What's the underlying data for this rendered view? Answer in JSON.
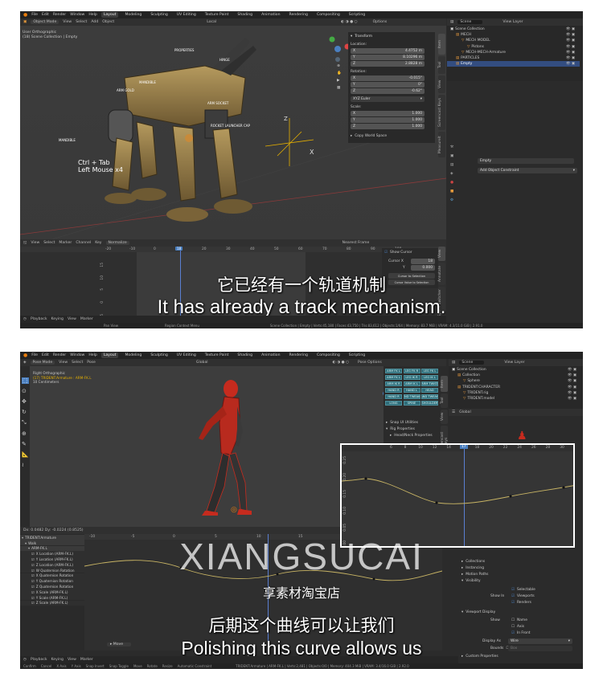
{
  "menu": [
    "File",
    "Edit",
    "Render",
    "Window",
    "Help"
  ],
  "workspaces": [
    "Layout",
    "Modeling",
    "Sculpting",
    "UV Editing",
    "Texture Paint",
    "Shading",
    "Animation",
    "Rendering",
    "Compositing",
    "Scripting"
  ],
  "shot1": {
    "header": {
      "mode": "Object Mode",
      "items": [
        "View",
        "Select",
        "Add",
        "Object"
      ],
      "transform": "Local",
      "options": "Options"
    },
    "viewport_info": [
      "User Orthographic",
      "(18) Scene Collection | Empty"
    ],
    "bone_labels": [
      "PROPERTIES",
      "ARM GOLD",
      "ARM SOCKET",
      "MANDIBLE",
      "ROCKET LAUNCHER CAP",
      "MANDIBLE",
      "HINGE"
    ],
    "shortcut_hint": [
      "Ctrl + Tab",
      "Left Mouse x4"
    ],
    "transform_panel": {
      "title": "Transform",
      "location_label": "Location:",
      "location": [
        {
          "axis": "X",
          "value": "4.4752 m"
        },
        {
          "axis": "Y",
          "value": "8.10296 m"
        },
        {
          "axis": "Z",
          "value": "2.8828 m"
        }
      ],
      "rotation_label": "Rotation:",
      "rotation": [
        {
          "axis": "X",
          "value": "-0.015°"
        },
        {
          "axis": "Y",
          "value": "0°"
        },
        {
          "axis": "Z",
          "value": "-0.62°"
        }
      ],
      "euler": "XYZ Euler",
      "scale_label": "Scale:",
      "scale": [
        {
          "axis": "X",
          "value": "1.000"
        },
        {
          "axis": "Y",
          "value": "1.000"
        },
        {
          "axis": "Z",
          "value": "1.000"
        }
      ],
      "copy_btn": "Copy World Space"
    },
    "side_tabs": [
      "Item",
      "Tool",
      "View",
      "Screencast Keys",
      "MeasureIt"
    ],
    "outliner": {
      "search": "Scene",
      "view_layer": "View Layer",
      "items": [
        {
          "label": "Scene Collection",
          "indent": 0,
          "selected": false
        },
        {
          "label": "MECH",
          "indent": 1,
          "selected": false
        },
        {
          "label": "MECH MODEL",
          "indent": 2,
          "selected": false
        },
        {
          "label": "Pistons",
          "indent": 3,
          "selected": false
        },
        {
          "label": "MECH-MECH-Armature",
          "indent": 2,
          "selected": false
        },
        {
          "label": "PARTICLES",
          "indent": 1,
          "selected": false
        },
        {
          "label": "Empty",
          "indent": 1,
          "selected": true
        }
      ]
    },
    "props": {
      "object": "Empty",
      "constraint": "Add Object Constraint"
    },
    "graph": {
      "header": [
        "View",
        "Select",
        "Marker",
        "Channel",
        "Key"
      ],
      "normalize": "Normalize",
      "pivot": "Nearest Frame",
      "ticks": [
        "-20",
        "-10",
        "0",
        "10",
        "20",
        "30",
        "40",
        "50",
        "60",
        "70",
        "80",
        "90",
        "100"
      ],
      "current_frame": "18",
      "y_ticks": [
        "15",
        "10",
        "5",
        "0",
        "-5"
      ],
      "panel": {
        "show_cursor": "Show Cursor",
        "cursor_x_label": "Cursor X",
        "cursor_x": "18",
        "cursor_y_label": "Y",
        "cursor_y": "0.000",
        "btn1": "Cursor to Selection",
        "btn2": "Cursor Value to Selection"
      },
      "side_tabs": [
        "View",
        "Annotate",
        "Space Switcher"
      ]
    },
    "timeline": [
      "Playback",
      "Keying",
      "View",
      "Marker"
    ],
    "status": {
      "left": "Pan View",
      "mid": "Region Context Menu",
      "right": "Scene Collection | Empty | Verts:45,180 | Faces:43,750 | Tris:83,612 | Objects:1/64 | Memory: 83.7 MiB | VRAM: 4.3/11.0 GiB | 2.91.0"
    },
    "subtitle_zh": "它已经有一个轨道机制",
    "subtitle_en": "It has already a track mechanism."
  },
  "shot2": {
    "header": {
      "mode": "Pose Mode",
      "items": [
        "View",
        "Select",
        "Pose"
      ],
      "transform": "Global",
      "options": "Pose Options"
    },
    "viewport_info": [
      "Right Orthographic",
      "(17) TRIDENT:Armature : ARM-FK.L",
      "10 Centimeters"
    ],
    "picker_buttons": [
      [
        "ARM FK L",
        "LEG FK R",
        "LEG FK L"
      ],
      [
        "ARM FK L",
        "LEG IK R",
        "LEG IK L"
      ],
      [
        "ARM IK R",
        "ARM IK L",
        "ARM TWIST"
      ],
      [
        "HAND R",
        "HAND L",
        "HEAD"
      ],
      [
        "HAND R",
        "HAND TWEAK R",
        "HAND TWEAK L"
      ],
      [
        "LONG",
        "SPINE",
        "SHOULDER"
      ]
    ],
    "n_panel": [
      "Snap UI Utilities",
      "Rig Properties",
      "Head/Neck Properties"
    ],
    "side_tabs": [
      "Item",
      "Tool",
      "View",
      "Screencast Keys"
    ],
    "outliner": {
      "search": "Scene",
      "view_layer": "View Layer",
      "items": [
        {
          "label": "Scene Collection",
          "indent": 0,
          "selected": false
        },
        {
          "label": "Collection",
          "indent": 1,
          "selected": false
        },
        {
          "label": "Sphere",
          "indent": 2,
          "selected": false
        },
        {
          "label": "TRIDENT:CHARACTER",
          "indent": 1,
          "selected": false
        },
        {
          "label": "TRIDENT.rig",
          "indent": 2,
          "selected": false
        },
        {
          "label": "TRIDENT.model",
          "indent": 2,
          "selected": false
        }
      ]
    },
    "graph_header": "Dx: 0.0482  Dy: -0.0224 (0.8525)",
    "channels": [
      {
        "label": "TRIDENT:Armature",
        "level": 0
      },
      {
        "label": "Walk",
        "level": 1
      },
      {
        "label": "ARM-FK.L",
        "level": 2
      },
      {
        "label": "X Location (ARM-FK.L)",
        "level": 3
      },
      {
        "label": "Y Location (ARM-FK.L)",
        "level": 3
      },
      {
        "label": "Z Location (ARM-FK.L)",
        "level": 3
      },
      {
        "label": "W Quaternion Rotation",
        "level": 3
      },
      {
        "label": "X Quaternion Rotation",
        "level": 3
      },
      {
        "label": "Y Quaternion Rotation",
        "level": 3
      },
      {
        "label": "Z Quaternion Rotation",
        "level": 3
      },
      {
        "label": "X Scale (ARM-FK.L)",
        "level": 3
      },
      {
        "label": "Y Scale (ARM-FK.L)",
        "level": 3
      },
      {
        "label": "Z Scale (ARM-FK.L)",
        "level": 3
      }
    ],
    "ticks": [
      "-10",
      "-5",
      "0",
      "5",
      "10",
      "15",
      "20",
      "25",
      "30"
    ],
    "zoom_ticks": [
      "6",
      "8",
      "10",
      "12",
      "14",
      "16",
      "18",
      "20",
      "22",
      "24",
      "26",
      "28",
      "30",
      "32"
    ],
    "zoom_frame": "17",
    "zoom_yticks": [
      "0.25",
      "0.20",
      "0.15",
      "0.10",
      "0.05",
      "0.00"
    ],
    "move_label": "Move",
    "props": [
      "Collections",
      "Instancing",
      "Motion Paths",
      "Visibility",
      "Viewport Display",
      "Custom Properties"
    ],
    "visibility": [
      {
        "label": "Selectable",
        "checked": true
      },
      {
        "label": "Viewports",
        "checked": true
      },
      {
        "label": "Renders",
        "checked": true
      }
    ],
    "show_in": "Show In",
    "display": [
      {
        "label": "Name",
        "checked": false
      },
      {
        "label": "Axis",
        "checked": false
      },
      {
        "label": "In Front",
        "checked": true
      }
    ],
    "show_label": "Show",
    "display_as_label": "Display As",
    "display_as": "Wire",
    "bounds_label": "Bounds",
    "bounds": "Box",
    "timeline": [
      "Playback",
      "Keying",
      "View",
      "Marker"
    ],
    "status": [
      "Confirm",
      "Cancel",
      "X Axis",
      "Y Axis",
      "Snap Invert",
      "Snap Toggle",
      "Move",
      "Rotate",
      "Resize",
      "Automatic Constraint"
    ],
    "status_right": "TRIDENT:Armature | ARM-FK.L | Verts:2,481 | Objects:0/0 | Memory: 404.3 MiB | VRAM: 3.4/16.0 GiB | 2.92.0",
    "watermark": "XIANGSUCAI",
    "watermark_sub": "享素材淘宝店",
    "subtitle_zh": "后期这个曲线可以让我们",
    "subtitle_en": "Polishing this curve allows us"
  },
  "colors": {
    "accent": "#4a7fc0",
    "selected_row": "#334d80",
    "teal": "#2f6d7a",
    "curve": "#c8b464",
    "frame_line": "#5a7fd1"
  }
}
